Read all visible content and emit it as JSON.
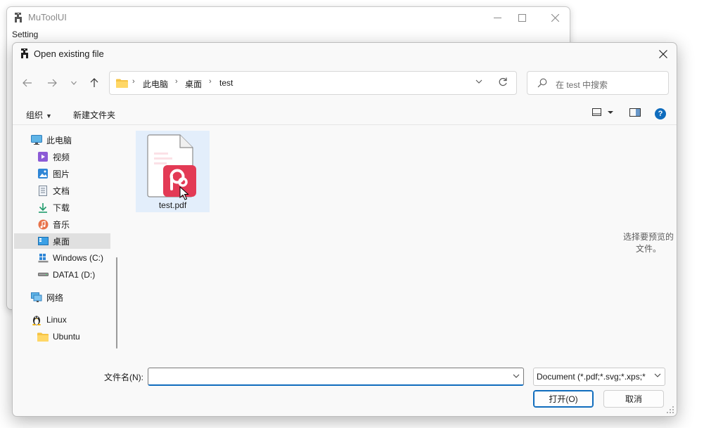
{
  "main_window": {
    "title": "MuToolUI",
    "menu": {
      "setting": "Setting"
    },
    "controls": {
      "minimize": "—",
      "maximize": "☐",
      "close": "✕"
    }
  },
  "dialog": {
    "title": "Open existing file",
    "close": "✕",
    "address": {
      "crumbs": [
        "此电脑",
        "桌面",
        "test"
      ],
      "separator": "›"
    },
    "search": {
      "placeholder": "在 test 中搜索"
    },
    "commands": {
      "organize": "组织",
      "new_folder": "新建文件夹"
    },
    "nav_tree": [
      {
        "label": "此电脑",
        "icon": "computer-icon"
      },
      {
        "label": "视频",
        "icon": "video-icon"
      },
      {
        "label": "图片",
        "icon": "pictures-icon"
      },
      {
        "label": "文档",
        "icon": "documents-icon"
      },
      {
        "label": "下载",
        "icon": "download-icon"
      },
      {
        "label": "音乐",
        "icon": "music-icon"
      },
      {
        "label": "桌面",
        "icon": "desktop-icon",
        "selected": true
      },
      {
        "label": "Windows (C:)",
        "icon": "drive-c-icon"
      },
      {
        "label": "DATA1 (D:)",
        "icon": "drive-d-icon"
      },
      {
        "label": "网络",
        "icon": "network-icon"
      },
      {
        "label": "Linux",
        "icon": "linux-icon"
      },
      {
        "label": "Ubuntu",
        "icon": "folder-icon"
      }
    ],
    "files": [
      {
        "name": "test.pdf",
        "icon": "pdf-file-icon"
      }
    ],
    "preview_message": "选择要预览的文件。",
    "filename_label": "文件名(N):",
    "filename_value": "",
    "file_type_filter": "Document (*.pdf;*.svg;*.xps;*",
    "buttons": {
      "open": "打开(O)",
      "cancel": "取消"
    },
    "help": "?"
  },
  "colors": {
    "accent": "#0f6cbd",
    "pdf_red": "#e33a55",
    "selection": "#e3eefb",
    "folder_yellow": "#f5c344"
  }
}
